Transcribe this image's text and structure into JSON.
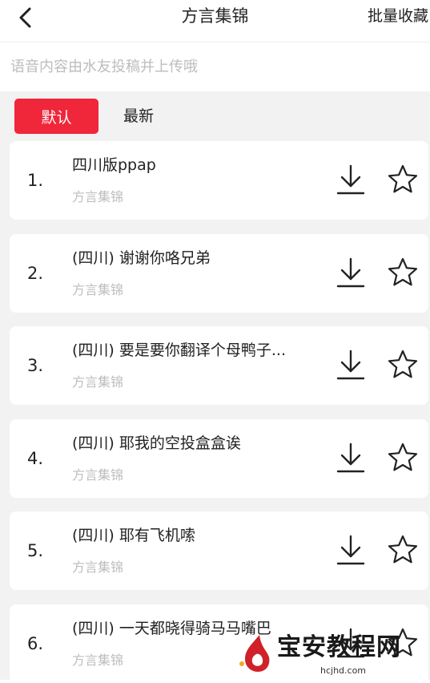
{
  "header": {
    "back_icon": "chevron-left-icon",
    "title": "方言集锦",
    "batch_label": "批量收藏"
  },
  "subtitle": "语音内容由水友投稿并上传哦",
  "tabs": [
    {
      "label": "默认",
      "active": true
    },
    {
      "label": "最新",
      "active": false
    }
  ],
  "accent_color": "#f0263a",
  "items": [
    {
      "num": "1.",
      "title": "四川版ppap",
      "sub": "方言集锦"
    },
    {
      "num": "2.",
      "title": "(四川) 谢谢你咯兄弟",
      "sub": "方言集锦"
    },
    {
      "num": "3.",
      "title": "(四川) 要是要你翻译个母鸭子...",
      "sub": "方言集锦"
    },
    {
      "num": "4.",
      "title": "(四川) 耶我的空投盒盒诶",
      "sub": "方言集锦"
    },
    {
      "num": "5.",
      "title": "(四川) 耶有飞机嗦",
      "sub": "方言集锦"
    },
    {
      "num": "6.",
      "title": "(四川) 一天都晓得骑马马嘴巴",
      "sub": "方言集锦"
    }
  ],
  "item_icons": [
    "download-icon",
    "star-outline-icon"
  ],
  "watermark": {
    "text": "宝安教程网",
    "url": "hcjhd.com"
  }
}
